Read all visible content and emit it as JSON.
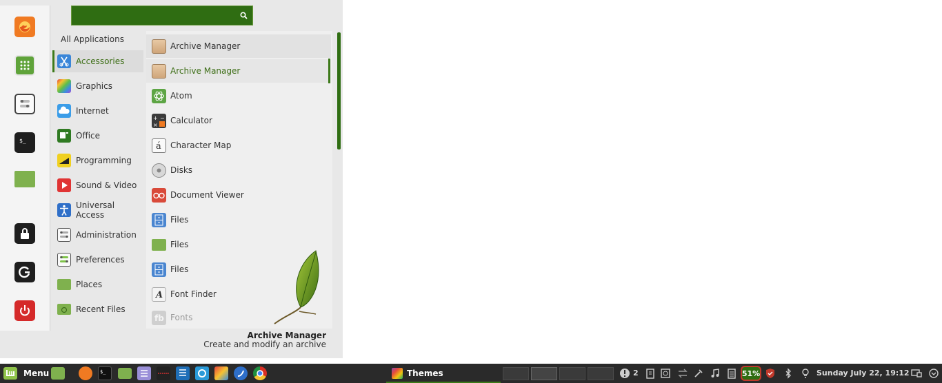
{
  "search": {
    "value": "",
    "placeholder": ""
  },
  "categories": {
    "all_label": "All Applications",
    "items": [
      {
        "label": "Accessories"
      },
      {
        "label": "Graphics"
      },
      {
        "label": "Internet"
      },
      {
        "label": "Office"
      },
      {
        "label": "Programming"
      },
      {
        "label": "Sound & Video"
      },
      {
        "label": "Universal Access"
      },
      {
        "label": "Administration"
      },
      {
        "label": "Preferences"
      },
      {
        "label": "Places"
      },
      {
        "label": "Recent Files"
      }
    ]
  },
  "apps": [
    {
      "label": "Archive Manager"
    },
    {
      "label": "Archive Manager"
    },
    {
      "label": "Atom"
    },
    {
      "label": "Calculator"
    },
    {
      "label": "Character Map"
    },
    {
      "label": "Disks"
    },
    {
      "label": "Document Viewer"
    },
    {
      "label": "Files"
    },
    {
      "label": "Files"
    },
    {
      "label": "Files"
    },
    {
      "label": "Font Finder"
    },
    {
      "label": "Fonts"
    }
  ],
  "description": {
    "title": "Archive Manager",
    "text": "Create and modify an archive"
  },
  "taskbar": {
    "menu_label": "Menu",
    "window_label": "Themes",
    "notification_count": "2",
    "battery_percent": "51%",
    "clock": "Sunday July 22, 19:12"
  },
  "colors": {
    "accent": "#3d7a1a",
    "search_bg": "#2f6d12",
    "panel_bg": "#2a2a2a"
  }
}
